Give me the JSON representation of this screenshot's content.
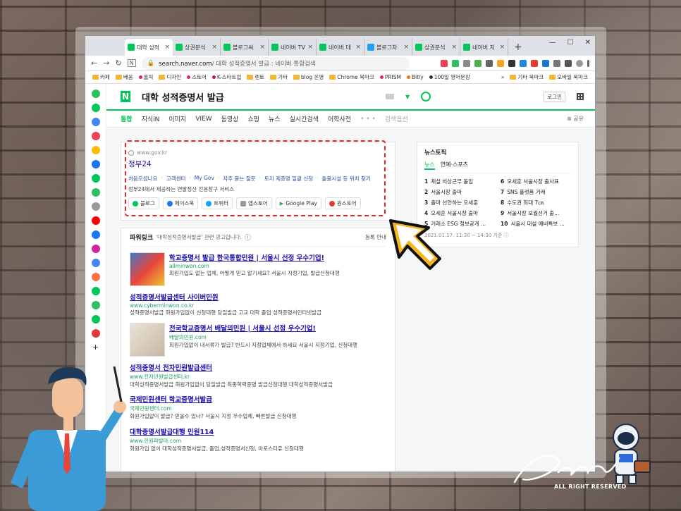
{
  "tabs": [
    {
      "label": "대학 성적",
      "active": true,
      "color": "#03c75a"
    },
    {
      "label": "상권분석",
      "color": "#03c75a"
    },
    {
      "label": "블로그씨",
      "color": "#03c75a"
    },
    {
      "label": "네이버 TV",
      "color": "#03c75a"
    },
    {
      "label": "네이버 데",
      "color": "#03c75a"
    },
    {
      "label": "블로그차",
      "color": "#1da1f2"
    },
    {
      "label": "상권분석",
      "color": "#03c75a"
    },
    {
      "label": "네이버 지",
      "color": "#03c75a"
    }
  ],
  "omnibox": {
    "domain": "search.naver.com",
    "path": "대학 성적증명서 발급 : 네이버 통합검색"
  },
  "bookmarks": [
    "카페",
    "배움",
    "홈픽",
    "디자인",
    "스토어",
    "K-스타트업",
    "렌토",
    "기타",
    "blog 운영",
    "Chrome 북마크",
    "PRISM",
    "Bitly",
    "100일 영어문장"
  ],
  "bookmarks_right": [
    "기타 북마크",
    "모바일 북마크"
  ],
  "search": {
    "query": "대학 성적증명서 발급",
    "login": "로그인"
  },
  "nav_tabs": [
    "통합",
    "지식iN",
    "이미지",
    "VIEW",
    "동영상",
    "쇼핑",
    "뉴스",
    "실시간검색",
    "어학사전"
  ],
  "nav_more": "검색옵션",
  "nav_share": "공유",
  "gov": {
    "site": "www.gov.kr",
    "title": "정부24",
    "links": [
      "처음오셨나요",
      "고객센터",
      "My Gov",
      "자주 묻는 질문",
      "토지 제증명 일괄 신청",
      "돌봄시설 등 위치 찾기"
    ],
    "desc": "정부24에서 제공하는 연말정산 전용창구 서비스",
    "buttons": [
      "블로그",
      "페이스북",
      "트위터",
      "앱스토어",
      "Google Play",
      "원스토어"
    ]
  },
  "powerlink": {
    "title": "파워링크",
    "subtitle": "'대학성적증명서발급' 관련 광고입니다.",
    "register": "등록 안내"
  },
  "ads": [
    {
      "title": "학교증명서 발급 한국통합민원 | 서울시 선정 우수기업!",
      "url": "allminwon.com",
      "desc": "회원가입도 없는 업체, 어떻게 믿고 맡기세요? 서울시 지정기업, 발급신청대행",
      "thumb": true
    },
    {
      "title": "성적증명서발급센터 사이버민원",
      "url": "www.cyberminwon.co.kr",
      "desc": "성적증명서발급 회원가입없이 신청대행 당일발급 고교 대학 졸업 성적증명서인터넷발급"
    },
    {
      "title": "전국학교증명서 배달의민원 | 서울시 선정 우수기업!",
      "url": "배달의민원.com",
      "desc": "회원가입없이 내서류가 발급? 반드시 지정업체에서 하세요 서울시 지정기업, 신청대행",
      "thumb": true
    },
    {
      "title": "성적증명서 전자민원발급센터",
      "url": "www.전자민원발급센터.kr",
      "desc": "대학성적증명서발급 회원가입없이 당일발급 최종학력증명 발급신청대행 대학성적증명서발급"
    },
    {
      "title": "국제민원센터 학교증명서발급",
      "url": "국제민원센터.com",
      "desc": "회원가입없이 발급? 믿을수 있나? 서울시 지정 우수업체, 빠른발급 신청대행"
    },
    {
      "title": "대학증명서발급대행 민원114",
      "url": "www.민원파발마.com",
      "desc": "회원가입 없이 대학성적증명서발급, 졸업,성적증명서신청, 아포스티유 신청대행"
    }
  ],
  "news": {
    "title": "뉴스토픽",
    "tabs": [
      "뉴스",
      "연예·스포츠"
    ],
    "items": [
      "제설 비상근무 돌입",
      "서울시장 출마",
      "출마 선언하는 오세훈",
      "오세훈 서울시장 출마",
      "거래소 ESG 정보공개 ...",
      "오세훈 서울시장 출사표",
      "SNS 플랫폼 거래",
      "수도권 최대 7㎝",
      "서울시장 보궐선거 출...",
      "서울시 대설 예비특보 ..."
    ],
    "time": "2021.01.17. 11:30 ~ 14:30 기준"
  },
  "signature": {
    "rights": "ALL RIGHT RESERVED"
  }
}
